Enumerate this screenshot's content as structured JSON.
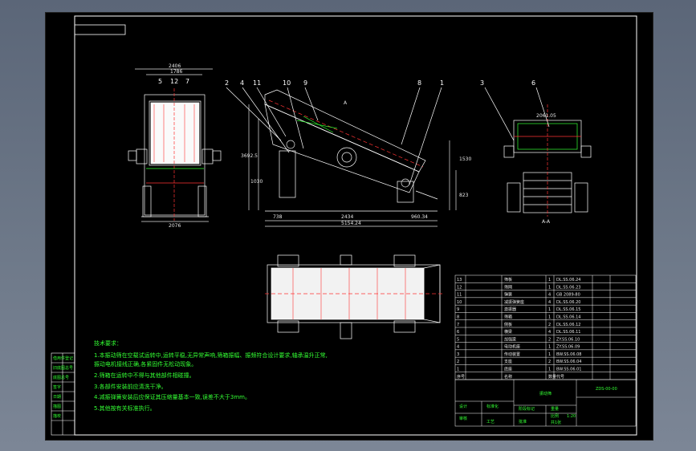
{
  "binding": [
    "借用件登记",
    "旧底图总号",
    "底图总号",
    "签字",
    "日期",
    "描图",
    "描校"
  ],
  "front_view": {
    "dim_top": "2406",
    "dim_top2": "1786",
    "callouts": [
      "5",
      "12",
      "7"
    ],
    "dim_bottom": "2076"
  },
  "side_view": {
    "callouts": [
      "2",
      "4",
      "11",
      "10",
      "9",
      "8",
      "1"
    ],
    "dim_left": "738",
    "dim_mid": "2434",
    "dim_right": "960.34",
    "dim_total": "5154.24",
    "dim_h1": "1530",
    "dim_h2": "823",
    "dim_h3": "1030",
    "dim_h4": "3692.5",
    "section_mark": "A"
  },
  "aa_view": {
    "callouts": [
      "3",
      "6"
    ],
    "dim_top": "2061.05",
    "title": "A-A"
  },
  "notes": {
    "heading": "技术要求：",
    "lines": [
      "1.本振动筛在空载试运转中,运转平稳,无异常声响,筛箱振幅、振频符合设计要求,轴承温升正常,",
      "振动电机接线正确,各紧固件无松动现象。",
      "2.筛箱在运转中不得与其他部件相碰撞。",
      "3.各部件安装前应清洗干净。",
      "4.减振弹簧安装后应保证其压缩量基本一致,误差不大于3mm。",
      "5.其他按有关标准执行。"
    ]
  },
  "parts": [
    {
      "no": "13",
      "name": "筛板",
      "qty": "1",
      "code": "DL.SS.06.24"
    },
    {
      "no": "12",
      "name": "筛网",
      "qty": "1",
      "code": "DL.SS.06.23"
    },
    {
      "no": "11",
      "name": "弹簧",
      "qty": "4",
      "code": "GB 2089-80"
    },
    {
      "no": "10",
      "name": "减振弹簧座",
      "qty": "4",
      "code": "DL.SS.06.20"
    },
    {
      "no": "9",
      "name": "激振器",
      "qty": "1",
      "code": "DL.SS.06.15"
    },
    {
      "no": "8",
      "name": "筛箱",
      "qty": "1",
      "code": "DL.SS.06.14"
    },
    {
      "no": "7",
      "name": "侧板",
      "qty": "2",
      "code": "DL.SS.06.12"
    },
    {
      "no": "6",
      "name": "横梁",
      "qty": "4",
      "code": "DL.SS.06.11"
    },
    {
      "no": "5",
      "name": "加强梁",
      "qty": "2",
      "code": "ZY.SS.06.10"
    },
    {
      "no": "4",
      "name": "电动机座",
      "qty": "1",
      "code": "ZY.SS.06.09"
    },
    {
      "no": "3",
      "name": "传动装置",
      "qty": "1",
      "code": "BW.SS.06.08"
    },
    {
      "no": "2",
      "name": "支座",
      "qty": "2",
      "code": "BW.SS.06.04"
    },
    {
      "no": "1",
      "name": "底座",
      "qty": "1",
      "code": "BW.SS.06.01"
    },
    {
      "no": "序号",
      "name": "名称",
      "qty": "数量",
      "code": "代号"
    }
  ],
  "title_block": {
    "title": "振动筛",
    "code": "ZDS-00-00",
    "cells": [
      "设计",
      "标准化",
      "阶段标记",
      "重量",
      "比例",
      "1:20",
      "审核",
      "工艺",
      "批准",
      "共1张"
    ]
  }
}
